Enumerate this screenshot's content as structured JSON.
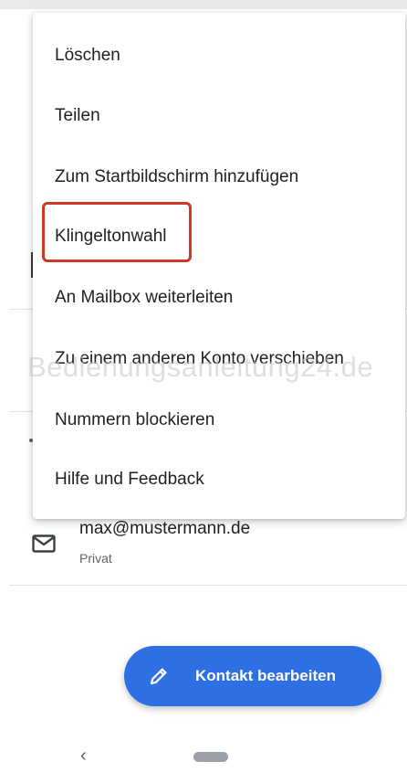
{
  "menu": {
    "items": [
      {
        "label": "Löschen"
      },
      {
        "label": "Teilen"
      },
      {
        "label": "Zum Startbildschirm hinzufügen"
      },
      {
        "label": "Klingeltonwahl"
      },
      {
        "label": "An Mailbox weiterleiten"
      },
      {
        "label": "Zu einem anderen Konto verschieben"
      },
      {
        "label": "Nummern blockieren"
      },
      {
        "label": "Hilfe und Feedback"
      }
    ],
    "highlighted_item": "Klingeltonwahl",
    "highlight_color": "#cc3a2a"
  },
  "watermark": "Bedienungsanleitung24.de",
  "contact": {
    "email": "max@mustermann.de",
    "email_type": "Privat",
    "email_icon": "mail-icon"
  },
  "fab": {
    "label": "Kontakt bearbeiten",
    "icon": "pencil-icon",
    "color": "#2f6fe4"
  },
  "navbar": {
    "back_glyph": "‹",
    "home": "home-pill"
  }
}
